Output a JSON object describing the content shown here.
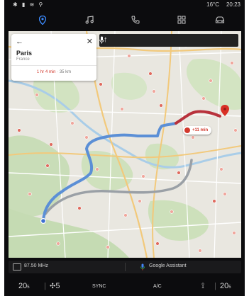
{
  "status": {
    "left_icons": [
      "bluetooth-icon",
      "signal-icon",
      "wifi-icon",
      "location-icon"
    ],
    "temperature": "16°C",
    "time": "20:23"
  },
  "nav": {
    "items": [
      {
        "name": "navigation",
        "icon": "map-pin-icon",
        "active": true
      },
      {
        "name": "music",
        "icon": "music-icon",
        "active": false
      },
      {
        "name": "phone",
        "icon": "phone-icon",
        "active": false
      },
      {
        "name": "apps",
        "icon": "apps-grid-icon",
        "active": false
      },
      {
        "name": "vehicle",
        "icon": "car-icon",
        "active": false
      }
    ]
  },
  "destination": {
    "city": "Paris",
    "country": "France",
    "duration": "1 hr 4 min",
    "separator": " · ",
    "distance": "35 km"
  },
  "route_badge": {
    "delay": "+11 min"
  },
  "media": {
    "radio": "87.50 MHz",
    "assistant": "Google Assistant"
  },
  "climate": {
    "left_temp": "20",
    "left_temp_unit": "5",
    "fan_speed": "5",
    "sync_label": "SYNC",
    "ac_label": "A/C",
    "right_temp": "20",
    "right_temp_unit": "5"
  },
  "colors": {
    "accent": "#3d8cff",
    "route_main": "#5b8fd6",
    "route_traffic": "#b8323c",
    "route_alt": "#9aa0a6",
    "eta_red": "#d23a2e"
  }
}
